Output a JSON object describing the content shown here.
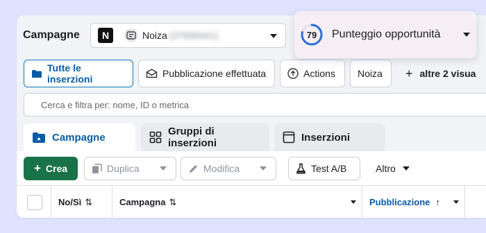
{
  "header": {
    "title": "Campagne",
    "account_logo_letter": "N",
    "account_name": "Noiza",
    "account_id": "(37998441)"
  },
  "score_popup": {
    "score": "79",
    "score_fraction": 0.79,
    "label": "Punteggio opportunità",
    "ring_color": "#2d6bd9"
  },
  "views": {
    "all_ads": "Tutte le inserzioni",
    "published": "Pubblicazione effettuata",
    "actions": "Actions",
    "noiza": "Noiza",
    "more": "altre 2 visua"
  },
  "search": {
    "placeholder": "Cerca e filtra per: nome, ID o metrica"
  },
  "tabs": {
    "campaigns": "Campagne",
    "adsets": "Gruppi di inserzioni",
    "ads": "Inserzioni"
  },
  "actions": {
    "create": "Crea",
    "duplicate": "Duplica",
    "edit": "Modifica",
    "ab_test": "Test A/B",
    "more": "Altro"
  },
  "table": {
    "columns": {
      "onoff": "No/Sì",
      "campaign": "Campagna",
      "delivery": "Pubblicazione"
    }
  },
  "colors": {
    "accent": "#0a5ca8",
    "create_button": "#1a7249",
    "background": "#dfe3ff"
  }
}
